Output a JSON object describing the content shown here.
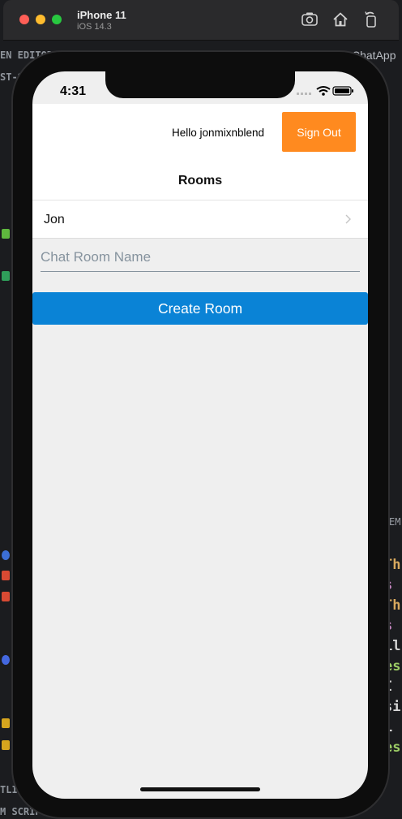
{
  "window": {
    "device_name": "iPhone 11",
    "os_version": "iOS 14.3"
  },
  "background": {
    "left_fragments": [
      "EN EDITOR",
      "ST-S"
    ],
    "right_app": "ChatApp",
    "right_small": "EM",
    "code_lines": [
      {
        "text": "Th",
        "color": "#d9a95e"
      },
      {
        "text": "s",
        "color": "#c586c0"
      },
      {
        "text": "Th",
        "color": "#d9a95e"
      },
      {
        "text": "s",
        "color": "#c586c0"
      },
      {
        "text": "il",
        "color": "#d4d4d4"
      },
      {
        "text": "es",
        "color": "#9ccc65"
      },
      {
        "text": " I",
        "color": "#d4d4d4"
      },
      {
        "text": "si",
        "color": "#d4d4d4"
      },
      {
        "text": " L",
        "color": "#d4d4d4"
      },
      {
        "text": "es",
        "color": "#9ccc65"
      }
    ],
    "bottom_fragments": [
      "TLIN",
      "M SCRIP"
    ]
  },
  "status_bar": {
    "time": "4:31"
  },
  "header": {
    "greeting": "Hello jonmixnblend",
    "sign_out_label": "Sign Out",
    "rooms_title": "Rooms"
  },
  "rooms": [
    {
      "name": "Jon"
    }
  ],
  "create_form": {
    "input_value": "",
    "input_placeholder": "Chat Room Name",
    "create_label": "Create Room"
  },
  "colors": {
    "sign_out": "#ff8a1f",
    "create_button": "#0a83d6",
    "screen_background": "#efefef"
  }
}
